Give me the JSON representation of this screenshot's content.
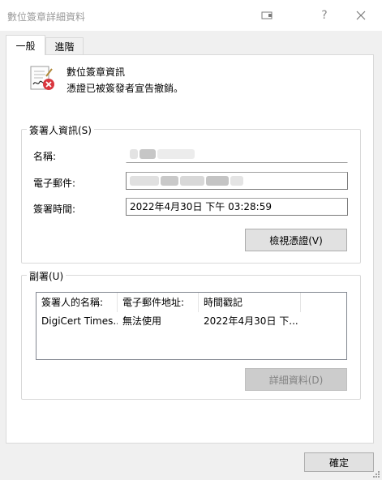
{
  "window": {
    "title": "數位簽章詳細資料"
  },
  "titlebar": {
    "help_label": "?"
  },
  "tabs": [
    {
      "label": "一般",
      "selected": true
    },
    {
      "label": "進階",
      "selected": false
    }
  ],
  "signature_info": {
    "title": "數位簽章資訊",
    "status": "憑證已被簽發者宣告撤銷。"
  },
  "signer_group": {
    "legend": "簽署人資訊(S)",
    "name_label": "名稱:",
    "email_label": "電子郵件:",
    "signing_time_label": "簽署時間:",
    "signing_time_value": "2022年4月30日 下午 03:28:59",
    "view_certificate_button": "檢視憑證(V)"
  },
  "countersignature_group": {
    "legend": "副署(U)",
    "columns": [
      "簽署人的名稱:",
      "電子郵件地址:",
      "時間戳記"
    ],
    "rows": [
      {
        "signer": "DigiCert Times...",
        "email": "無法使用",
        "timestamp": "2022年4月30日 下..."
      }
    ],
    "details_button": "詳細資料(D)"
  },
  "footer": {
    "ok_button": "確定"
  },
  "colors": {
    "revoked_badge": "#d9363e"
  },
  "icons": {
    "context_help": "context-help-icon",
    "close": "close-icon",
    "signature": "signature-revoked-icon"
  }
}
